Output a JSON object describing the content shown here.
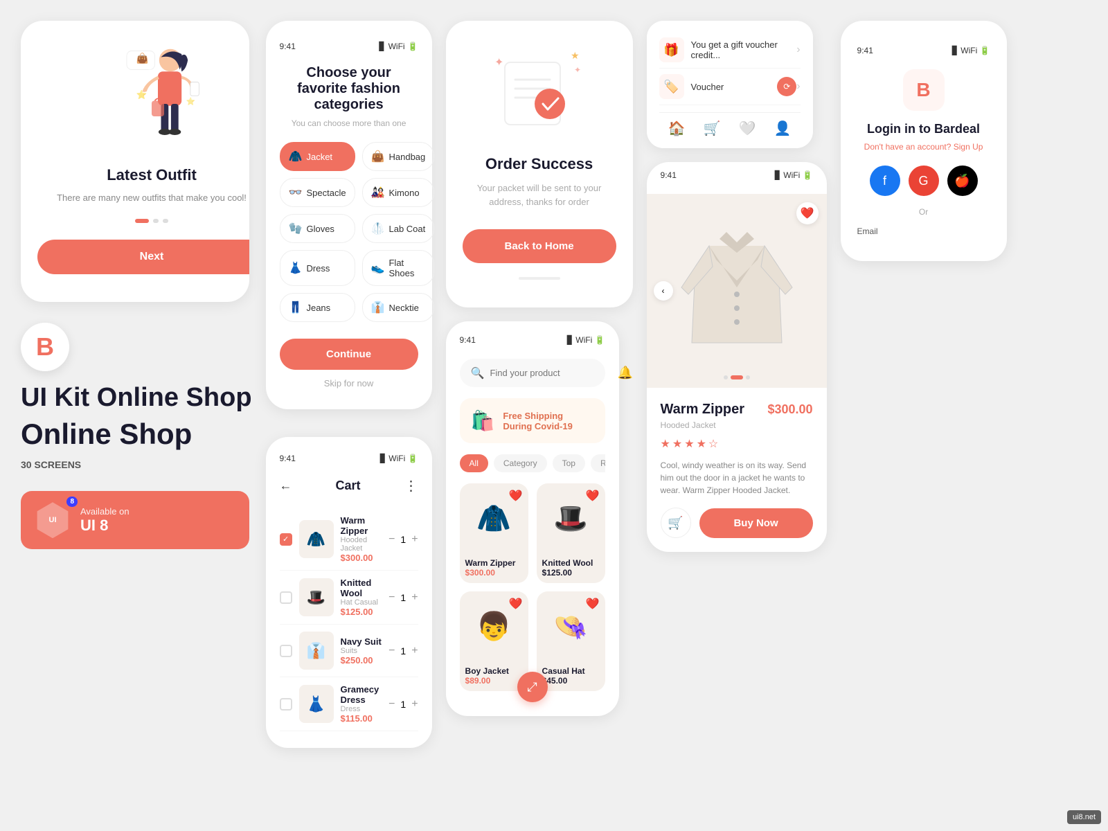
{
  "app": {
    "title": "UI Kit Online Shop",
    "subtitle": "Online Shop",
    "screens_count": "30 SCREENS",
    "ui8_badge": "Available on",
    "ui8_name": "UI 8",
    "ui8_number": "8"
  },
  "onboarding": {
    "title": "Latest Outfit",
    "description": "There are many new outfits that make you cool!",
    "next_button": "Next"
  },
  "categories": {
    "title": "Choose your favorite fashion categories",
    "subtitle": "You can choose more than one",
    "items": [
      {
        "name": "Jacket",
        "icon": "🧥",
        "active": true
      },
      {
        "name": "Handbag",
        "icon": "👜",
        "active": false
      },
      {
        "name": "Spectacle",
        "icon": "👓",
        "active": false
      },
      {
        "name": "Kimono",
        "icon": "🎎",
        "active": false
      },
      {
        "name": "Gloves",
        "icon": "🧤",
        "active": false
      },
      {
        "name": "Lab Coat",
        "icon": "🥼",
        "active": false
      },
      {
        "name": "Dress",
        "icon": "👗",
        "active": false
      },
      {
        "name": "Flat Shoes",
        "icon": "👟",
        "active": false
      },
      {
        "name": "Jeans",
        "icon": "👖",
        "active": false
      },
      {
        "name": "Necktie",
        "icon": "👔",
        "active": false
      }
    ],
    "continue_button": "Continue",
    "skip_text": "Skip for now"
  },
  "order_success": {
    "title": "Order Success",
    "description": "Your packet will be sent to your address, thanks for order",
    "back_button": "Back to Home"
  },
  "cart": {
    "title": "Cart",
    "items": [
      {
        "name": "Warm Zipper",
        "type": "Hooded Jacket",
        "price": "$300.00",
        "qty": 1,
        "checked": true
      },
      {
        "name": "Knitted Wool",
        "type": "Hat Casual",
        "price": "$125.00",
        "qty": 1,
        "checked": false
      },
      {
        "name": "Navy Suit",
        "type": "Suits",
        "price": "$250.00",
        "qty": 1,
        "checked": false
      },
      {
        "name": "Gramecy Dress",
        "type": "Dress",
        "price": "$115.00",
        "qty": 1,
        "checked": false
      }
    ]
  },
  "shop_browse": {
    "search_placeholder": "Find your product",
    "promo_text": "Free Shipping During Covid-19",
    "filters": [
      "All",
      "Category",
      "Top",
      "Recom..."
    ],
    "products": [
      {
        "name": "Warm Zipper",
        "price": "$300.00",
        "price_style": "red"
      },
      {
        "name": "Knitted Wool",
        "price": "$125.00",
        "price_style": "dark"
      }
    ]
  },
  "product_detail": {
    "name": "Warm Zipper",
    "category": "Hooded Jacket",
    "price": "$300.00",
    "rating": 4.5,
    "description": "Cool, windy weather is on its way. Send him out the door in a jacket he wants to wear. Warm Zipper Hooded Jacket.",
    "buy_button": "Buy Now"
  },
  "voucher": {
    "gift_text": "You get a gift voucher credit...",
    "voucher_label": "Voucher"
  },
  "login": {
    "title": "Login in to Bardeal",
    "no_account": "Don't have an account?",
    "sign_up": "Sign Up",
    "or_text": "Or",
    "email_label": "Email",
    "social": [
      "Facebook",
      "Google",
      "Apple"
    ]
  },
  "colors": {
    "primary": "#f07060",
    "dark": "#1a1a2e",
    "light_bg": "#f5f0eb"
  },
  "status_bar": {
    "time": "9:41"
  }
}
